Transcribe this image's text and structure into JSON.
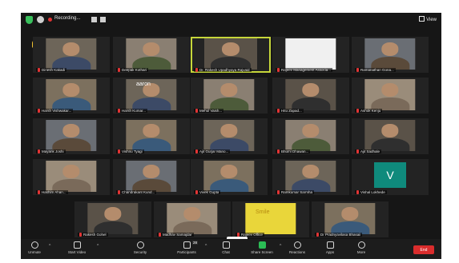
{
  "top_bar": {
    "recording_label": "Recording...",
    "view_label": "View"
  },
  "participants": [
    {
      "name": "Dinesh Kakadi"
    },
    {
      "name": "Deepak Kothari"
    },
    {
      "name": "Dr. Rakesh Upadhyaya Rajvaid"
    },
    {
      "name": "Rajeev Management Associa..."
    },
    {
      "name": "Ramanathan Gona..."
    },
    {
      "name": "Harsh Vishwakar..."
    },
    {
      "name": "Harsh Kumar..."
    },
    {
      "name": "Mehul Vaish..."
    },
    {
      "name": "Hitu Zapad..."
    },
    {
      "name": "Ashok Kenju"
    },
    {
      "name": "Mayank Joshi"
    },
    {
      "name": "Vishnu Tyagi"
    },
    {
      "name": "Ajit Gurjar Mano..."
    },
    {
      "name": "Bhumi Dhawan..."
    },
    {
      "name": "Ajit Sadhale"
    },
    {
      "name": "Hashim Ahan..."
    },
    {
      "name": "Chandrakant Kund..."
    },
    {
      "name": "Vivek Gupta"
    },
    {
      "name": "Ramkumar Sarmha"
    },
    {
      "name": "Vishal Lokhede"
    },
    {
      "name": "Rakesh Gohel"
    },
    {
      "name": "Madhav Samajdar"
    },
    {
      "name": "Rajeev Office"
    },
    {
      "name": "Dr Pradnyavilasa Bhasaii"
    }
  ],
  "special_tiles": {
    "v_initial": "V",
    "photo_text": "aaron",
    "sign_text": "Smile"
  },
  "toolbar": {
    "unmute": "Unmute",
    "start_video": "Start Video",
    "security": "Security",
    "participants": "Participants",
    "participants_count": "28",
    "chat": "Chat",
    "share_screen": "Share Screen",
    "reactions": "Reactions",
    "apps": "Apps",
    "more": "More",
    "end": "End"
  }
}
